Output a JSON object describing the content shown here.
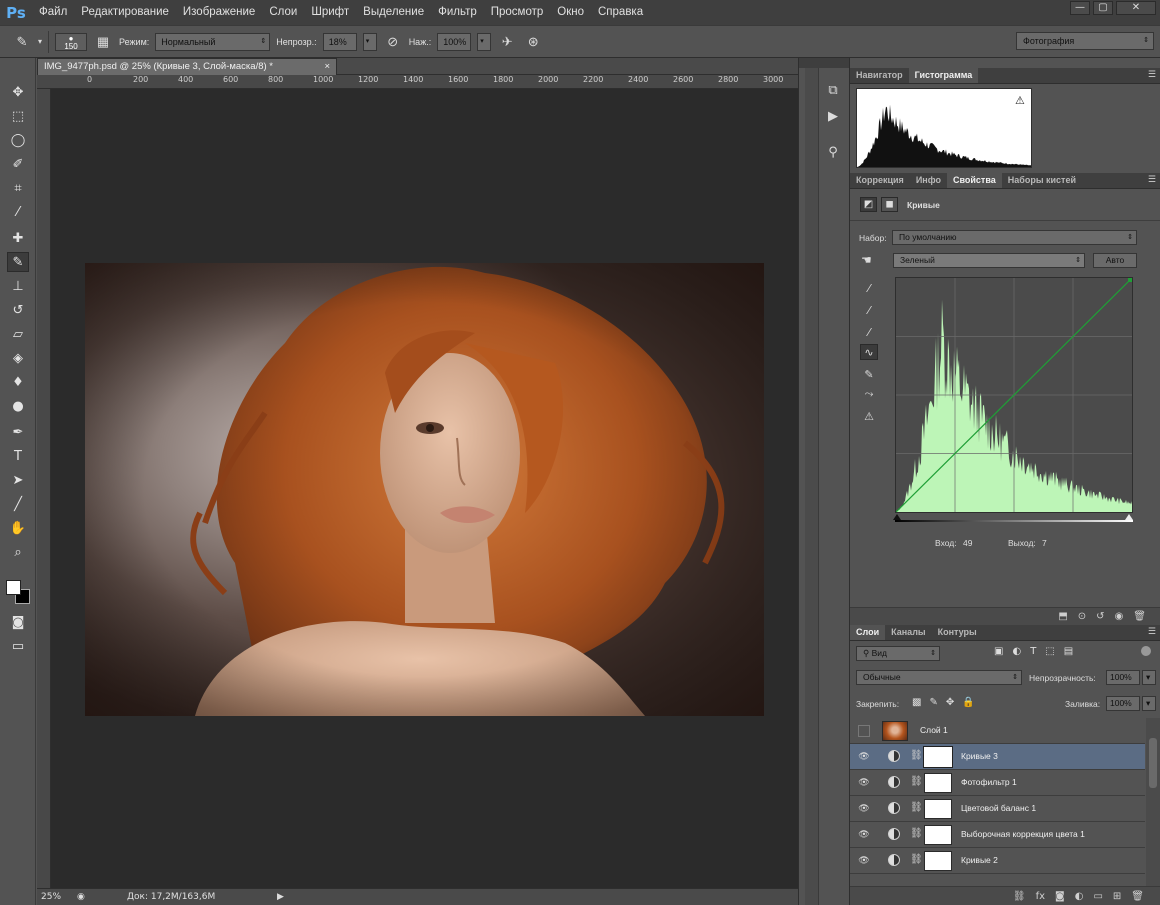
{
  "app": {
    "logo": "Ps",
    "menu": [
      "Файл",
      "Редактирование",
      "Изображение",
      "Слои",
      "Шрифт",
      "Выделение",
      "Фильтр",
      "Просмотр",
      "Окно",
      "Справка"
    ],
    "window_controls": [
      "—",
      "▢",
      "✕"
    ]
  },
  "options": {
    "brush_size": "150",
    "mode_label": "Режим:",
    "mode_value": "Нормальный",
    "opacity_label": "Непрозр.:",
    "opacity_value": "18%",
    "flow_label": "Наж.:",
    "flow_value": "100%",
    "workspace": "Фотография"
  },
  "document": {
    "tab_title": "IMG_9477ph.psd @ 25% (Кривые 3, Слой-маска/8) *",
    "close_glyph": "×",
    "ruler_ticks": [
      "0",
      "200",
      "400",
      "600",
      "800",
      "1000",
      "1200",
      "1400",
      "1600",
      "1800",
      "2000",
      "2200",
      "2400",
      "2600",
      "2800",
      "3000"
    ],
    "zoom": "25%",
    "doc_info": "Док: 17,2M/163,6M"
  },
  "panels": {
    "top_tabs": [
      "Навигатор",
      "Гистограмма"
    ],
    "mid_tabs": [
      "Коррекция",
      "Инфо",
      "Свойства",
      "Наборы кистей"
    ],
    "properties": {
      "title": "Кривые",
      "preset_label": "Набор:",
      "preset_value": "По умолчанию",
      "channel_value": "Зеленый",
      "auto_button": "Авто",
      "input_label": "Вход:",
      "input_value": "49",
      "output_label": "Выход:",
      "output_value": "7"
    },
    "layers": {
      "tabs": [
        "Слои",
        "Каналы",
        "Контуры"
      ],
      "filter_kind": "Вид",
      "blend_mode": "Обычные",
      "opacity_label": "Непрозрачность:",
      "opacity_value": "100%",
      "lock_label": "Закрепить:",
      "fill_label": "Заливка:",
      "fill_value": "100%",
      "items": [
        {
          "name": "Слой 1",
          "visible": false,
          "selected": false
        },
        {
          "name": "Кривые 3",
          "visible": true,
          "selected": true
        },
        {
          "name": "Фотофильтр 1",
          "visible": true,
          "selected": false
        },
        {
          "name": "Цветовой баланс 1",
          "visible": true,
          "selected": false
        },
        {
          "name": "Выборочная коррекция цвета 1",
          "visible": true,
          "selected": false
        },
        {
          "name": "Кривые 2",
          "visible": true,
          "selected": false
        }
      ]
    }
  },
  "colors": {
    "accent_histogram": "#bdf5b7",
    "curve_line": "#1f9f36",
    "selected_layer": "#5b6c84"
  }
}
